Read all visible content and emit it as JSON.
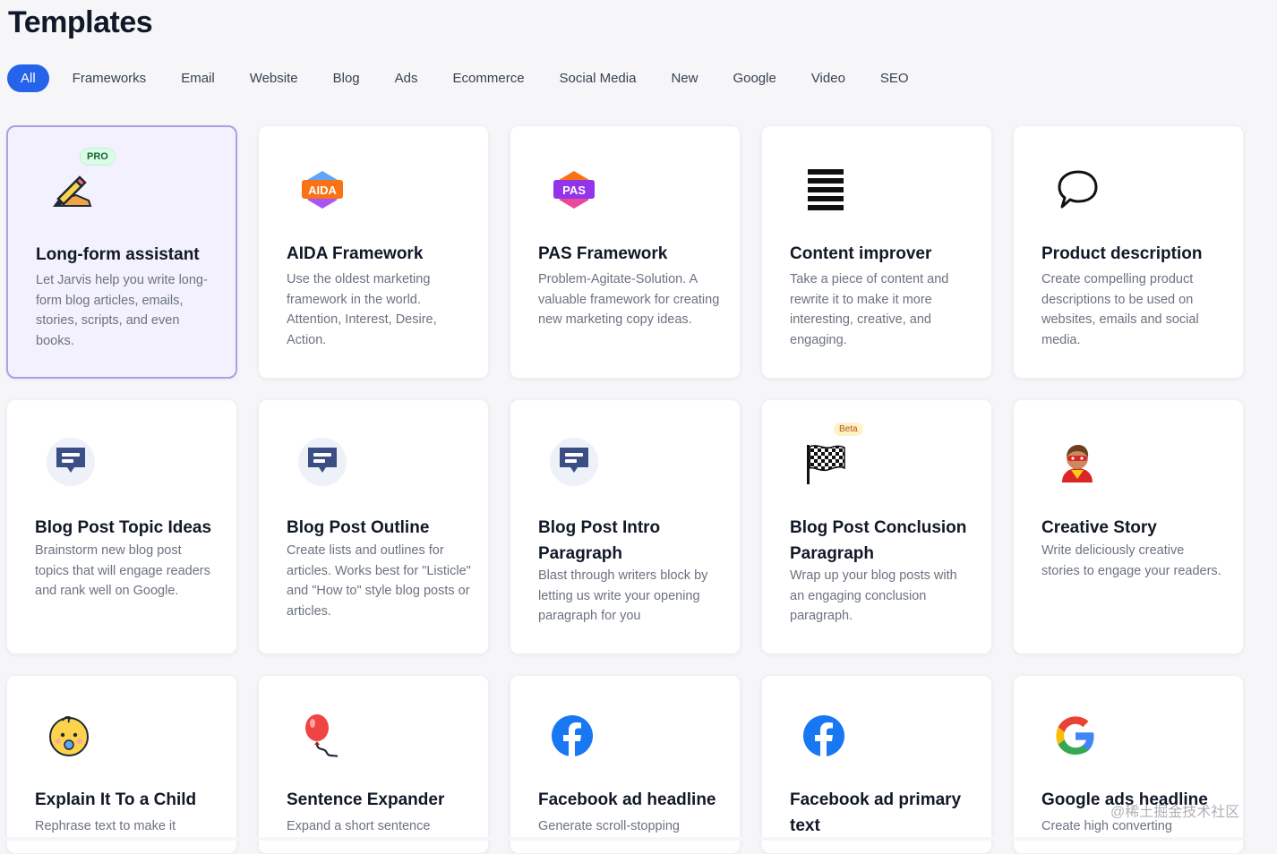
{
  "header": {
    "title": "Templates"
  },
  "tabs": [
    "All",
    "Frameworks",
    "Email",
    "Website",
    "Blog",
    "Ads",
    "Ecommerce",
    "Social Media",
    "New",
    "Google",
    "Video",
    "SEO"
  ],
  "badges": {
    "pro": "PRO",
    "beta": "Beta"
  },
  "cards": [
    {
      "title": "Long-form assistant",
      "desc": "Let Jarvis help you write long-form blog articles, emails, stories, scripts, and even books.",
      "icon": "pencil-icon"
    },
    {
      "title": "AIDA Framework",
      "desc": "Use the oldest marketing framework in the world. Attention, Interest, Desire, Action.",
      "icon": "aida-icon",
      "icon_text": "AIDA"
    },
    {
      "title": "PAS Framework",
      "desc": "Problem-Agitate-Solution. A valuable framework for creating new marketing copy ideas.",
      "icon": "pas-icon",
      "icon_text": "PAS"
    },
    {
      "title": "Content improver",
      "desc": "Take a piece of content and rewrite it to make it more interesting, creative, and engaging.",
      "icon": "lines-icon"
    },
    {
      "title": "Product description",
      "desc": "Create compelling product descriptions to be used on websites, emails and social media.",
      "icon": "speech-bubble-icon"
    },
    {
      "title": "Blog Post Topic Ideas",
      "desc": "Brainstorm new blog post topics that will engage readers and rank well on Google.",
      "icon": "message-icon"
    },
    {
      "title": "Blog Post Outline",
      "desc": "Create lists and outlines for articles. Works best for \"Listicle\" and \"How to\" style blog posts or articles.",
      "icon": "message-icon"
    },
    {
      "title": "Blog Post Intro Paragraph",
      "desc": "Blast through writers block by letting us write your opening paragraph for you",
      "icon": "message-icon"
    },
    {
      "title": "Blog Post Conclusion Paragraph",
      "desc": "Wrap up your blog posts with an engaging conclusion paragraph.",
      "icon": "checkered-flag-icon"
    },
    {
      "title": "Creative Story",
      "desc": "Write deliciously creative stories to engage your readers.",
      "icon": "superhero-icon"
    },
    {
      "title": "Explain It To a Child",
      "desc": "Rephrase text to make it",
      "icon": "baby-icon"
    },
    {
      "title": "Sentence Expander",
      "desc": "Expand a short sentence",
      "icon": "balloon-icon"
    },
    {
      "title": "Facebook ad headline",
      "desc": "Generate scroll-stopping",
      "icon": "facebook-icon"
    },
    {
      "title": "Facebook ad primary text",
      "desc": "",
      "icon": "facebook-icon"
    },
    {
      "title": "Google ads headline",
      "desc": "Create high converting",
      "icon": "google-icon"
    }
  ],
  "watermark": "@稀土掘金技术社区",
  "colors": {
    "accent": "#2563eb",
    "selected_border": "#a9a1e6",
    "selected_bg": "#f3f1fd"
  }
}
